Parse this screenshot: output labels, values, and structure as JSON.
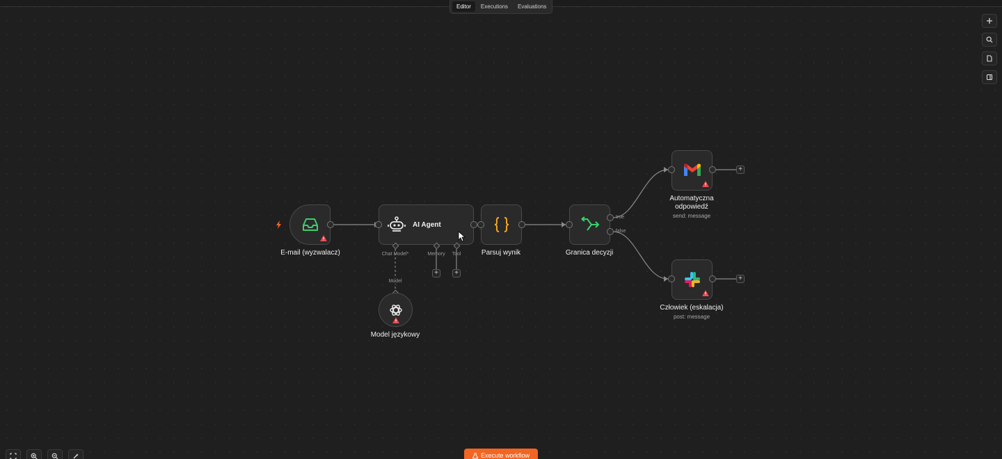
{
  "tabs": [
    {
      "label": "Editor",
      "active": true
    },
    {
      "label": "Executions",
      "active": false
    },
    {
      "label": "Evaluations",
      "active": false
    }
  ],
  "right_toolbar": [
    "plus-icon",
    "search-icon",
    "sticky-note-icon",
    "panel-icon"
  ],
  "nodes": {
    "trigger": {
      "label": "E-mail (wyzwalacz)",
      "icon": "inbox-icon",
      "icon_color": "#3ccf6e"
    },
    "agent": {
      "label": "AI Agent",
      "icon": "robot-icon"
    },
    "parse": {
      "label": "Parsuj wynik",
      "icon": "code-braces-icon",
      "icon_color": "#f5a623"
    },
    "decision": {
      "label": "Granica decyzji",
      "icon": "if-branch-icon",
      "icon_color": "#3ccf6e"
    },
    "gmail": {
      "label_line1": "Automatyczna",
      "label_line2": "odpowiedź",
      "subtitle": "send: message",
      "icon": "gmail-icon"
    },
    "slack": {
      "label": "Człowiek (eskalacja)",
      "subtitle": "post: message",
      "icon": "slack-icon"
    },
    "model": {
      "label": "Model językowy",
      "icon": "openai-icon"
    }
  },
  "agent_ports": {
    "chat_model": "Chat Model*",
    "memory": "Memory",
    "tool": "Tool"
  },
  "model_port": "Model",
  "branches": {
    "true": "true",
    "false": "false"
  },
  "execute_button": "Execute workflow",
  "colors": {
    "accent": "#f26522",
    "warning": "#e5484d",
    "background": "#1f1f1f"
  }
}
